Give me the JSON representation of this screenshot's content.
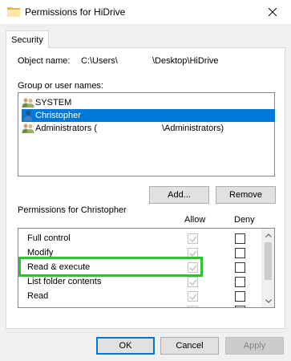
{
  "window": {
    "title": "Permissions for HiDrive",
    "close_glyph": "✕"
  },
  "tabs": [
    {
      "label": "Security",
      "active": true
    }
  ],
  "object": {
    "label": "Object name:",
    "path_prefix": "C:\\Users\\",
    "path_suffix": "\\Desktop\\HiDrive"
  },
  "groups": {
    "label": "Group or user names:",
    "items": [
      {
        "name": "SYSTEM",
        "icon": "users-group-icon",
        "selected": false
      },
      {
        "name": "Christopher",
        "icon": "user-icon",
        "selected": true
      },
      {
        "name": "Administrators (",
        "suffix": "\\Administrators)",
        "icon": "users-group-icon",
        "selected": false
      }
    ],
    "add_label": "Add...",
    "remove_label": "Remove"
  },
  "permissions": {
    "label": "Permissions for Christopher",
    "allow_header": "Allow",
    "deny_header": "Deny",
    "rows": [
      {
        "name": "Full control",
        "allow": true,
        "deny": false
      },
      {
        "name": "Modify",
        "allow": true,
        "deny": false
      },
      {
        "name": "Read & execute",
        "allow": true,
        "deny": false
      },
      {
        "name": "List folder contents",
        "allow": true,
        "deny": false
      },
      {
        "name": "Read",
        "allow": true,
        "deny": false
      },
      {
        "name": "",
        "allow": true,
        "deny": false
      }
    ],
    "highlight_color": "#2fc12f"
  },
  "footer": {
    "ok_label": "OK",
    "cancel_label": "Cancel",
    "apply_label": "Apply"
  },
  "colors": {
    "selection": "#0078d7",
    "panel_bg": "#f0f0f0"
  }
}
